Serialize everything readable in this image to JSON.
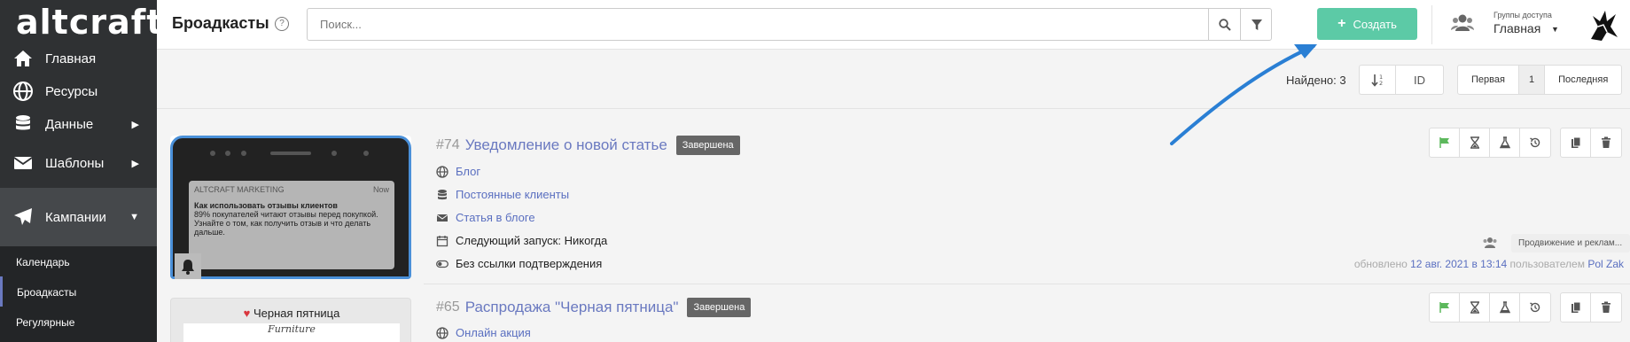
{
  "brand": {
    "logo_text": "altcraft",
    "accent": "#5ccaa6",
    "link": "#5a6fc0",
    "sidebar_bg": "#2f3133"
  },
  "sidebar": {
    "items": [
      {
        "label": "Главная",
        "icon": "home-icon"
      },
      {
        "label": "Ресурсы",
        "icon": "globe-icon"
      },
      {
        "label": "Данные",
        "icon": "database-icon"
      },
      {
        "label": "Шаблоны",
        "icon": "envelope-icon"
      },
      {
        "label": "Кампании",
        "icon": "paper-plane-icon"
      }
    ],
    "subitems": [
      {
        "label": "Календарь"
      },
      {
        "label": "Броадкасты"
      },
      {
        "label": "Регулярные"
      }
    ]
  },
  "header": {
    "title": "Броадкасты",
    "help": "?",
    "search_placeholder": "Поиск...",
    "create_label": "Создать",
    "groups_label": "Группы доступа",
    "groups_value": "Главная"
  },
  "toolbar": {
    "found": "Найдено: 3",
    "sort_id": "ID",
    "pager": {
      "first": "Первая",
      "current": "1",
      "last": "Последняя"
    }
  },
  "campaigns": [
    {
      "num": "#74",
      "name": "Уведомление о новой статье",
      "status": "Завершена",
      "resource": "Блог",
      "segment": "Постоянные клиенты",
      "template": "Статья в блоге",
      "next_run": "Следующий запуск: Никогда",
      "confirm": "Без ссылки подтверждения",
      "tag": "Продвижение и реклам...",
      "updated_prefix": "обновлено",
      "updated_date": "12 авг. 2021 в 13:14",
      "updated_by_prefix": "пользователем",
      "updated_user": "Pol Zak",
      "preview": {
        "app": "ALTCRAFT MARKETING",
        "time": "Now",
        "heading": "Как использовать отзывы клиентов",
        "body": "89% покупателей читают отзывы перед покупкой. Узнайте о том, как получить отзыв и что делать дальше."
      }
    },
    {
      "num": "#65",
      "name": "Распродажа \"Черная пятница\"",
      "status": "Завершена",
      "resource": "Онлайн акция",
      "preview": {
        "heading": "Черная пятница",
        "brand": "Furniture"
      }
    }
  ]
}
